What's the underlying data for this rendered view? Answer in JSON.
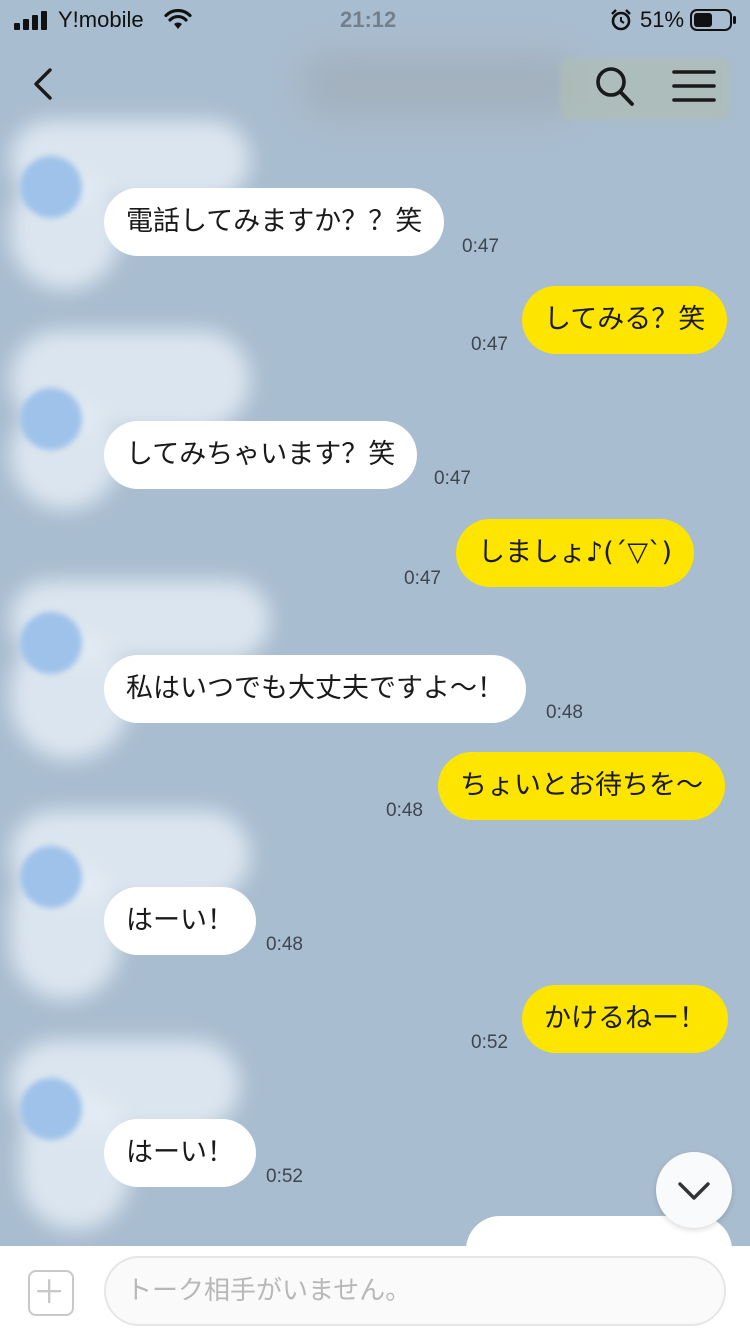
{
  "status_bar": {
    "carrier": "Y!mobile",
    "time": "21:12",
    "battery": "51%"
  },
  "header": {
    "back_icon": "chevron-left-icon",
    "search_icon": "search-icon",
    "menu_icon": "menu-icon"
  },
  "messages": [
    {
      "side": "in",
      "text": "電話してみますか？？笑",
      "time": "0:47"
    },
    {
      "side": "out",
      "text": "してみる？笑",
      "time": "0:47"
    },
    {
      "side": "in",
      "text": "してみちゃいます？笑",
      "time": "0:47"
    },
    {
      "side": "out",
      "text": "しましょ♪(´▽`)",
      "time": "0:47"
    },
    {
      "side": "in",
      "text": "私はいつでも大丈夫ですよ〜！",
      "time": "0:48"
    },
    {
      "side": "out",
      "text": "ちょいとお待ちを〜",
      "time": "0:48"
    },
    {
      "side": "in",
      "text": "はーい！",
      "time": "0:48"
    },
    {
      "side": "out",
      "text": "かけるねー！",
      "time": "0:52"
    },
    {
      "side": "in",
      "text": "はーい！",
      "time": "0:52"
    }
  ],
  "input": {
    "placeholder": "トーク相手がいません。"
  },
  "colors": {
    "background": "#a9bdd0",
    "outgoing_bubble": "#fde500",
    "incoming_bubble": "#ffffff"
  }
}
